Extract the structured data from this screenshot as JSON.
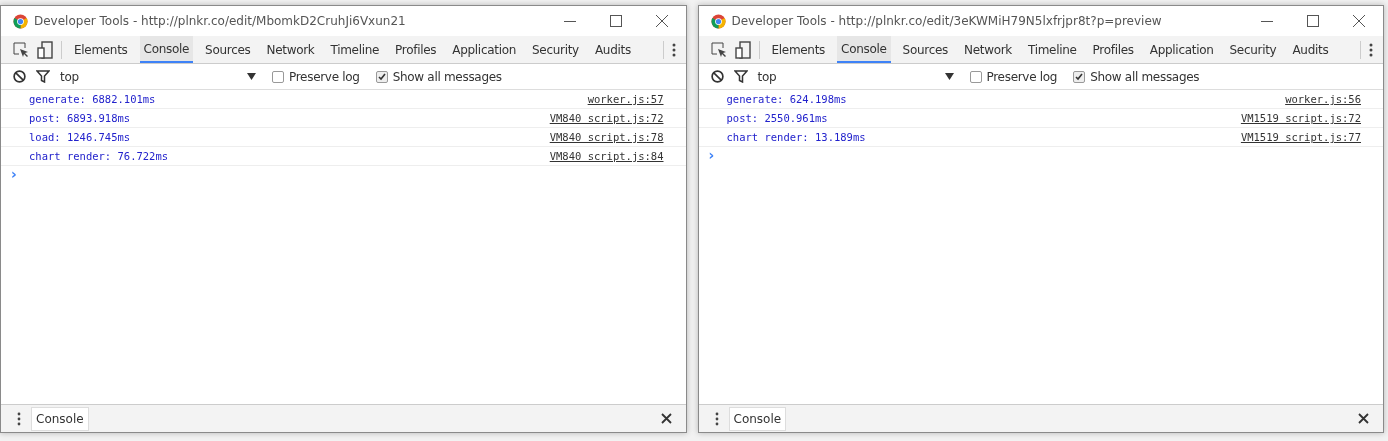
{
  "windows": [
    {
      "title": "Developer Tools - http://plnkr.co/edit/MbomkD2CruhJi6Vxun21",
      "tabs": [
        {
          "label": "Elements",
          "selected": false
        },
        {
          "label": "Console",
          "selected": true
        },
        {
          "label": "Sources",
          "selected": false
        },
        {
          "label": "Network",
          "selected": false
        },
        {
          "label": "Timeline",
          "selected": false
        },
        {
          "label": "Profiles",
          "selected": false
        },
        {
          "label": "Application",
          "selected": false
        },
        {
          "label": "Security",
          "selected": false
        },
        {
          "label": "Audits",
          "selected": false
        }
      ],
      "filter": {
        "context": "top",
        "preserve_log": false,
        "show_all_messages": true,
        "preserve_label": "Preserve log",
        "show_all_label": "Show all messages"
      },
      "messages": [
        {
          "text": "generate: 6882.101ms",
          "source": "worker.js:57"
        },
        {
          "text": "post: 6893.918ms",
          "source": "VM840 script.js:72"
        },
        {
          "text": "load: 1246.745ms",
          "source": "VM840 script.js:78"
        },
        {
          "text": "chart render: 76.722ms",
          "source": "VM840 script.js:84"
        }
      ],
      "prompt": "›",
      "drawer_tab": "Console"
    },
    {
      "title": "Developer Tools - http://plnkr.co/edit/3eKWMiH79N5lxfrjpr8t?p=preview",
      "tabs": [
        {
          "label": "Elements",
          "selected": false
        },
        {
          "label": "Console",
          "selected": true
        },
        {
          "label": "Sources",
          "selected": false
        },
        {
          "label": "Network",
          "selected": false
        },
        {
          "label": "Timeline",
          "selected": false
        },
        {
          "label": "Profiles",
          "selected": false
        },
        {
          "label": "Application",
          "selected": false
        },
        {
          "label": "Security",
          "selected": false
        },
        {
          "label": "Audits",
          "selected": false
        }
      ],
      "filter": {
        "context": "top",
        "preserve_log": false,
        "show_all_messages": true,
        "preserve_label": "Preserve log",
        "show_all_label": "Show all messages"
      },
      "messages": [
        {
          "text": "generate: 624.198ms",
          "source": "worker.js:56"
        },
        {
          "text": "post: 2550.961ms",
          "source": "VM1519 script.js:72"
        },
        {
          "text": "chart render: 13.189ms",
          "source": "VM1519 script.js:77"
        }
      ],
      "prompt": "›",
      "drawer_tab": "Console"
    }
  ]
}
